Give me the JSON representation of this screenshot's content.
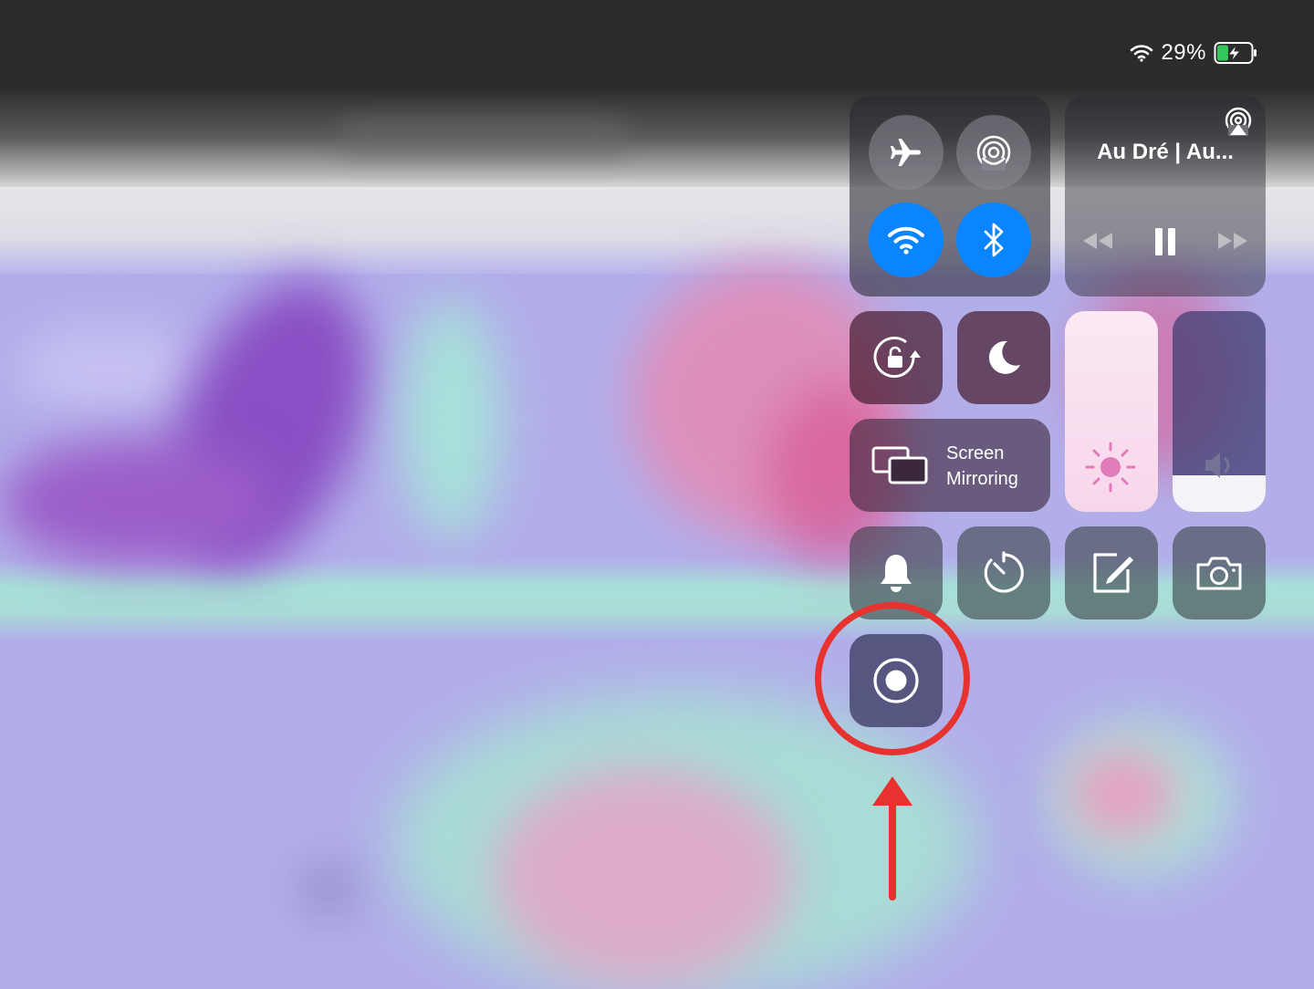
{
  "status_bar": {
    "wifi_icon": "wifi-icon",
    "battery_percent": "29%",
    "battery_icon": "battery-charging-icon",
    "battery_color": "#34c759"
  },
  "control_center": {
    "connectivity": {
      "airplane_mode": {
        "icon": "airplane-icon",
        "on": false
      },
      "airdrop": {
        "icon": "airdrop-icon",
        "on": false
      },
      "wifi": {
        "icon": "wifi-icon",
        "on": true
      },
      "bluetooth": {
        "icon": "bluetooth-icon",
        "on": true
      },
      "active_color": "#0a84ff"
    },
    "now_playing": {
      "title": "Au Dré | Au...",
      "airplay_icon": "airplay-icon",
      "controls": [
        "rewind-icon",
        "pause-icon",
        "fast-forward-icon"
      ]
    },
    "orientation_lock": {
      "icon": "rotation-lock-icon"
    },
    "do_not_disturb": {
      "icon": "moon-icon"
    },
    "screen_mirroring": {
      "line1": "Screen",
      "line2": "Mirroring",
      "icon": "screen-mirroring-icon"
    },
    "brightness": {
      "icon": "sun-icon",
      "level": 1.0
    },
    "volume": {
      "icon": "speaker-icon",
      "level": 0.18
    },
    "shortcuts": [
      "bell-icon",
      "timer-icon",
      "notes-icon",
      "camera-icon"
    ],
    "screen_recording": {
      "icon": "record-icon"
    }
  },
  "annotation": {
    "highlight_color": "#e8322f",
    "target": "screen-recording-button"
  }
}
